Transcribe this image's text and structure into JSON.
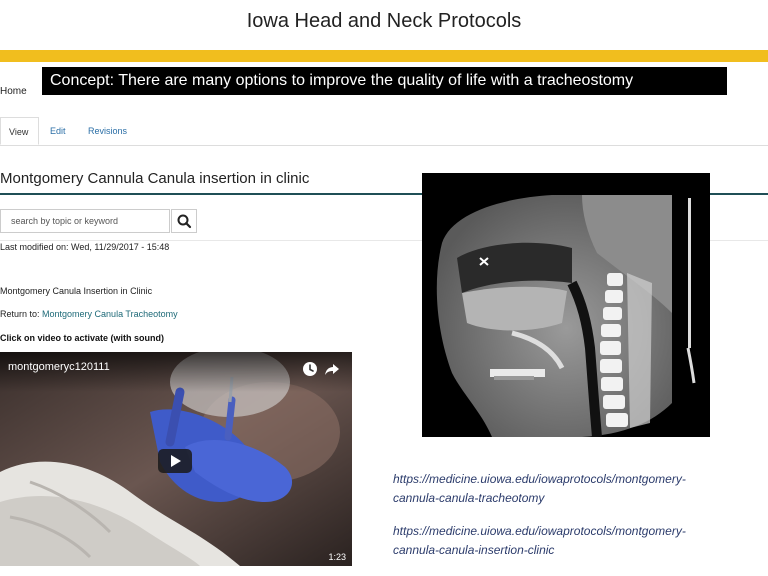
{
  "slide": {
    "title": "Iowa Head and Neck Protocols",
    "concept": "Concept:  There are many options to improve the quality of life with a tracheostomy"
  },
  "breadcrumb": {
    "home": "Home"
  },
  "tabs": [
    {
      "label": "View"
    },
    {
      "label": "Edit"
    },
    {
      "label": "Revisions"
    }
  ],
  "page": {
    "title": "Montgomery Cannula Canula insertion in clinic",
    "last_modified": "Last modified on: Wed, 11/29/2017 - 15:48",
    "subtitle": "Montgomery Canula Insertion in Clinic",
    "return_to_prefix": "Return to: ",
    "return_to_link": "Montgomery Canula Tracheotomy",
    "video_note": "Click on video to activate (with sound)"
  },
  "search": {
    "placeholder": "search by topic or keyword"
  },
  "video": {
    "title": "montgomeryc120111",
    "duration": "1:23"
  },
  "links": [
    {
      "line1": "https://medicine.uiowa.edu/iowaprotocols/montgomery-",
      "line2": "cannula-canula-tracheotomy"
    },
    {
      "line1": "https://medicine.uiowa.edu/iowaprotocols/montgomery-",
      "line2": "cannula-canula-insertion-clinic"
    }
  ],
  "colors": {
    "gold": "#f1be1e",
    "teal": "#1f4f56",
    "link": "#2a6ea6",
    "url_text": "#2b3b6b"
  },
  "icons": [
    "search-icon",
    "clock-icon",
    "share-icon",
    "play-icon"
  ]
}
